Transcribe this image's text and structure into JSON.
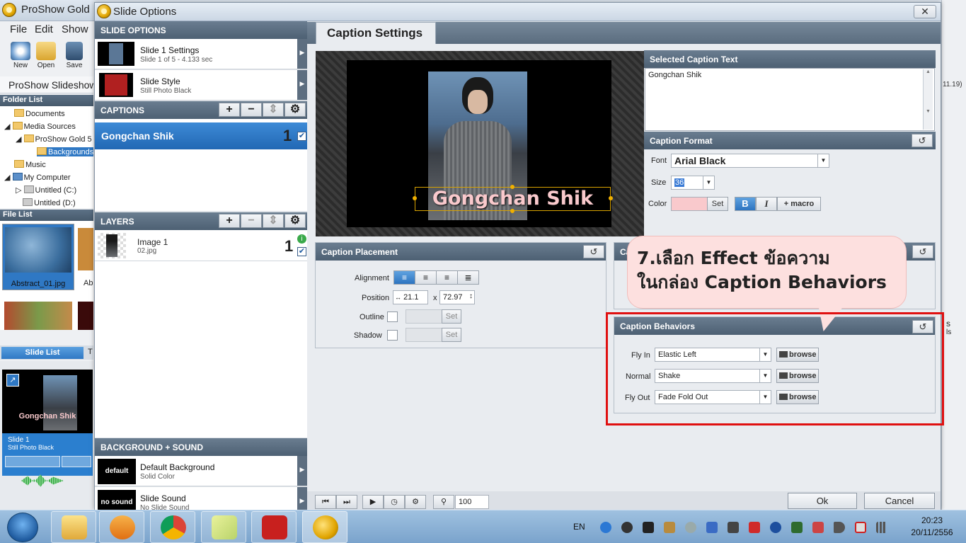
{
  "bg_app": {
    "title": "ProShow Gold",
    "menu": [
      "File",
      "Edit",
      "Show"
    ],
    "toolbar": [
      "New",
      "Open",
      "Save"
    ],
    "project_name": "ProShow Slideshow",
    "folder_list_title": "Folder List",
    "folders": [
      "Documents",
      "Media Sources",
      "ProShow Gold 5",
      "Backgrounds",
      "Music",
      "My Computer",
      "Untitled (C:)",
      "Untitled (D:)"
    ],
    "file_list_title": "File List",
    "files": [
      "Abstract_01.jpg",
      "Ab"
    ],
    "slide_list_tab": "Slide List",
    "slide_list_tab2": "T",
    "slide": {
      "caption": "Gongchan Shik",
      "name": "Slide 1",
      "style": "Still Photo Black"
    },
    "right_edge": {
      "ver": "11.19)",
      "s": "s",
      "ls": "ls"
    }
  },
  "dialog": {
    "title": "Slide Options",
    "close": "✕",
    "slide_options_header": "SLIDE OPTIONS",
    "slide_settings": {
      "title": "Slide 1 Settings",
      "sub": "Slide 1 of 5 - 4.133 sec"
    },
    "slide_style": {
      "title": "Slide Style",
      "sub": "Still Photo Black"
    },
    "captions_header": "CAPTIONS",
    "caption_item": {
      "label": "Gongchan Shik",
      "number": "1"
    },
    "layers_header": "LAYERS",
    "layer_item": {
      "title": "Image 1",
      "sub": "02.jpg",
      "number": "1"
    },
    "bg_sound_header": "BACKGROUND + SOUND",
    "default_bg": {
      "thumb": "default",
      "title": "Default Background",
      "sub": "Solid Color"
    },
    "slide_sound": {
      "thumb": "no sound",
      "title": "Slide Sound",
      "sub": "No Slide Sound"
    },
    "active_tab": "Caption Settings",
    "preview_caption": "Gongchan Shik",
    "selected_caption": {
      "header": "Selected Caption Text",
      "value": "Gongchan Shik"
    },
    "caption_format": {
      "header": "Caption Format",
      "font_label": "Font",
      "font_value": "Arial Black",
      "size_label": "Size",
      "size_value": "36",
      "color_label": "Color",
      "color_swatch": "#f9c9cc",
      "set_label": "Set",
      "bold": "B",
      "italic": "I",
      "macro": "+ macro"
    },
    "caption_placement": {
      "header": "Caption Placement",
      "alignment_label": "Alignment",
      "position_label": "Position",
      "pos_x": "21.1",
      "pos_sep": "x",
      "pos_y": "72.97",
      "outline_label": "Outline",
      "shadow_label": "Shadow",
      "set_label": "Set"
    },
    "caption_hidden_header": "Ca",
    "callout": {
      "line1": "7.เลือก Effect ข้อความ",
      "line2": "ในกล่อง Caption Behaviors"
    },
    "caption_behaviors": {
      "header": "Caption Behaviors",
      "fly_in_label": "Fly In",
      "fly_in_value": "Elastic Left",
      "normal_label": "Normal",
      "normal_value": "Shake",
      "fly_out_label": "Fly Out",
      "fly_out_value": "Fade Fold Out",
      "browse": "browse"
    },
    "zoom_value": "100",
    "ok": "Ok",
    "cancel": "Cancel"
  },
  "taskbar": {
    "lang": "EN",
    "time": "20:23",
    "date": "20/11/2556"
  },
  "colors": {
    "accent": "#2d74c0",
    "header": "#4d6073",
    "callout": "#fde0df",
    "highlight_box": "#e01010"
  }
}
